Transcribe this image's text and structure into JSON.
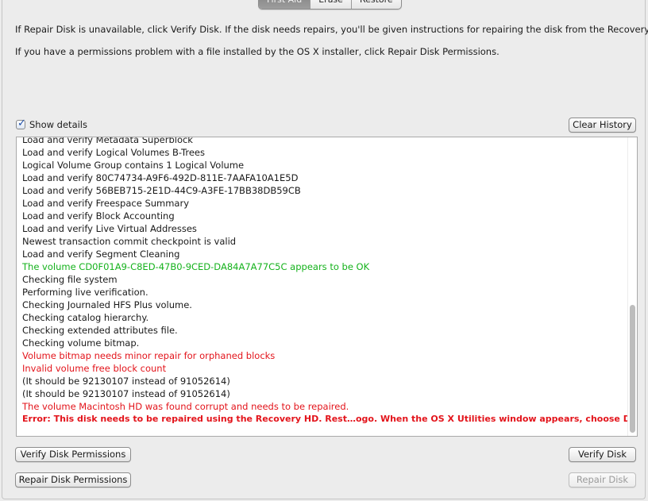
{
  "tabs": [
    {
      "label": "First Aid",
      "active": true
    },
    {
      "label": "Erase",
      "active": false
    },
    {
      "label": "Restore",
      "active": false
    }
  ],
  "info": {
    "line1": "If Repair Disk is unavailable, click Verify Disk. If the disk needs repairs, you'll be given instructions for repairing the disk from the Recovery HD.",
    "line2": "If you have a permissions problem with a file installed by the OS X installer, click Repair Disk Permissions."
  },
  "show_details": {
    "label": "Show details",
    "checked": true
  },
  "buttons": {
    "clear_history": "Clear History",
    "verify_permissions": "Verify Disk Permissions",
    "repair_permissions": "Repair Disk Permissions",
    "verify_disk": "Verify Disk",
    "repair_disk": "Repair Disk"
  },
  "log": [
    {
      "text": "Load and verify Metadata Superblock",
      "type": "normal"
    },
    {
      "text": "Load and verify Logical Volumes B-Trees",
      "type": "normal"
    },
    {
      "text": "Logical Volume Group contains 1 Logical Volume",
      "type": "normal"
    },
    {
      "text": "Load and verify 80C74734-A9F6-492D-811E-7AAFA10A1E5D",
      "type": "normal"
    },
    {
      "text": "Load and verify 56BEB715-2E1D-44C9-A3FE-17BB38DB59CB",
      "type": "normal"
    },
    {
      "text": "Load and verify Freespace Summary",
      "type": "normal"
    },
    {
      "text": "Load and verify Block Accounting",
      "type": "normal"
    },
    {
      "text": "Load and verify Live Virtual Addresses",
      "type": "normal"
    },
    {
      "text": "Newest transaction commit checkpoint is valid",
      "type": "normal"
    },
    {
      "text": "Load and verify Segment Cleaning",
      "type": "normal"
    },
    {
      "text": "The volume CD0F01A9-C8ED-47B0-9CED-DA84A7A77C5C appears to be OK",
      "type": "ok"
    },
    {
      "text": "Checking file system",
      "type": "normal"
    },
    {
      "text": "Performing live verification.",
      "type": "normal"
    },
    {
      "text": "Checking Journaled HFS Plus volume.",
      "type": "normal"
    },
    {
      "text": "Checking catalog hierarchy.",
      "type": "normal"
    },
    {
      "text": "Checking extended attributes file.",
      "type": "normal"
    },
    {
      "text": "Checking volume bitmap.",
      "type": "normal"
    },
    {
      "text": "Volume bitmap needs minor repair for orphaned blocks",
      "type": "warn"
    },
    {
      "text": "Invalid volume free block count",
      "type": "warn"
    },
    {
      "text": "(It should be 92130107 instead of 91052614)",
      "type": "normal"
    },
    {
      "text": "(It should be 92130107 instead of 91052614)",
      "type": "normal"
    },
    {
      "text": "The volume Macintosh HD was found corrupt and needs to be repaired.",
      "type": "warn"
    },
    {
      "text": "Error: This disk needs to be repaired using the Recovery HD. Rest…ogo. When the OS X Utilities window appears, choose Disk Utility.",
      "type": "err"
    }
  ],
  "scroll": {
    "position": 0.55,
    "visible_fraction": 0.45
  },
  "colors": {
    "ok": "#15b21c",
    "error": "#e3141b",
    "checkbox_check": "#1f4fa8"
  }
}
